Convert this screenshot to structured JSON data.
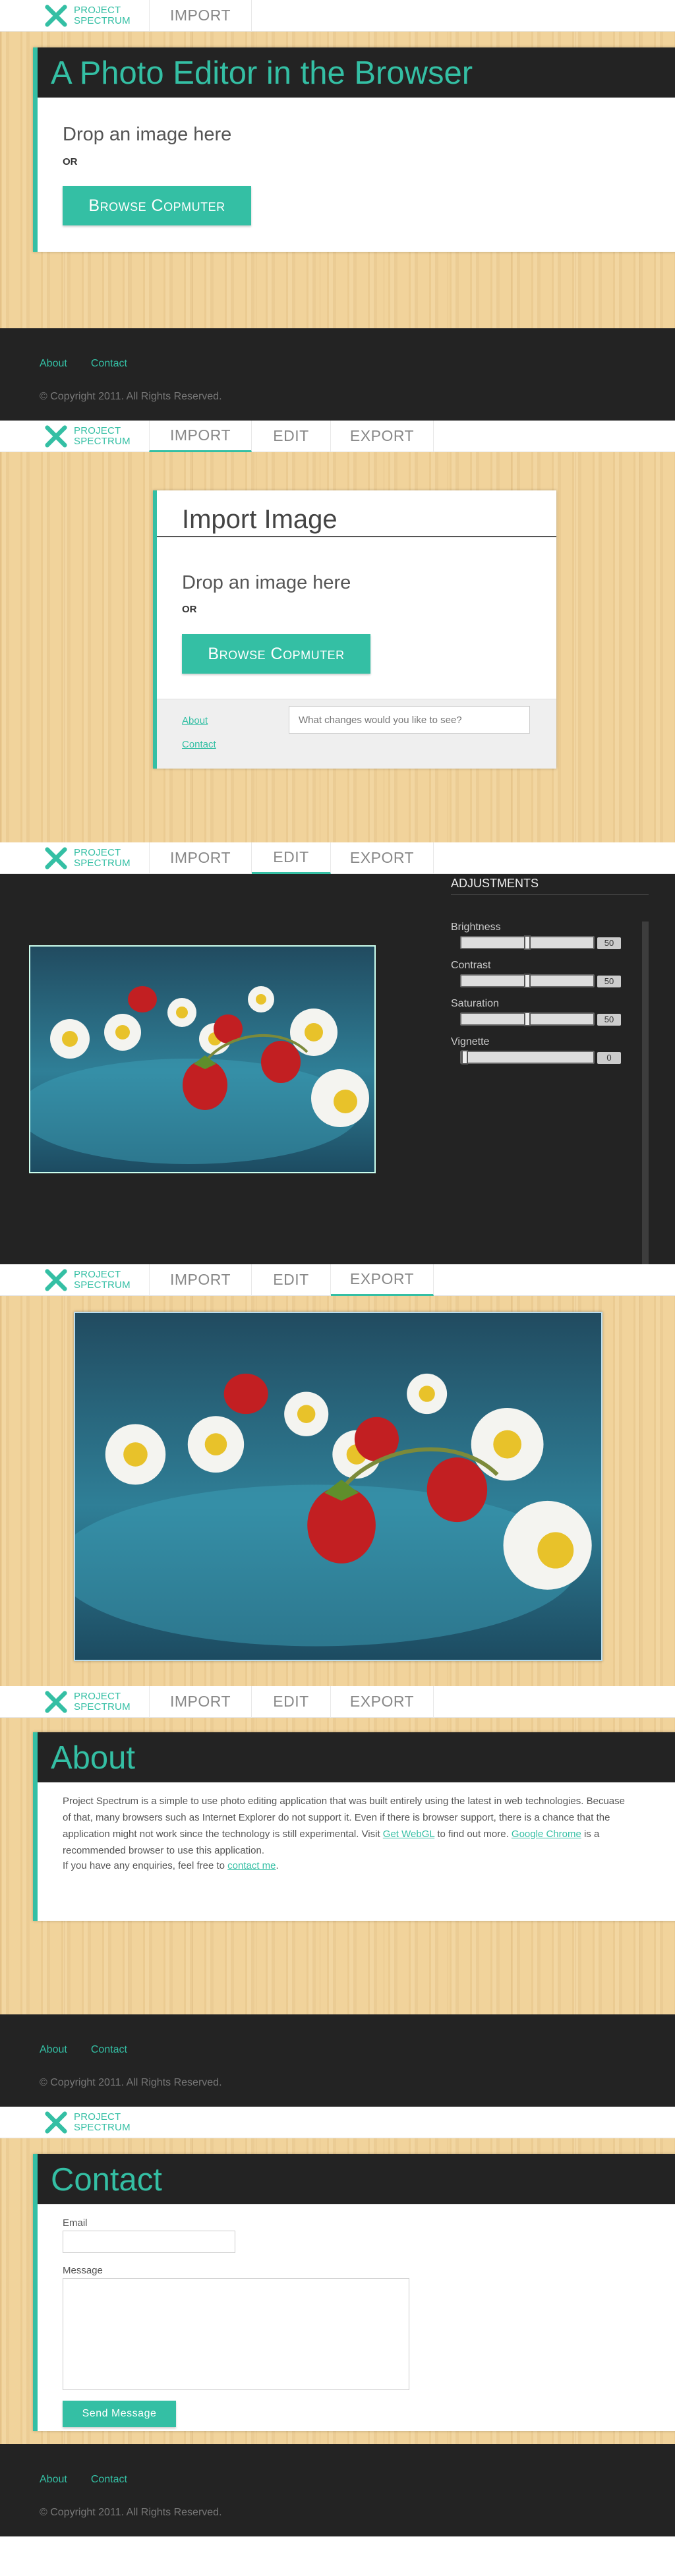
{
  "brand": {
    "line1": "PROJECT",
    "line2": "SPECTRUM"
  },
  "nav": {
    "import": "IMPORT",
    "edit": "EDIT",
    "export": "EXPORT"
  },
  "home": {
    "title": "A Photo Editor in the Browser",
    "drop": "Drop an image here",
    "or": "OR",
    "browse": "Browse Copmuter"
  },
  "footer": {
    "about": "About",
    "contact": "Contact",
    "copyright": "© Copyright 2011. All Rights Reserved."
  },
  "import_page": {
    "title": "Import Image",
    "drop": "Drop an image here",
    "or": "OR",
    "browse": "Browse Copmuter",
    "about": "About",
    "contact": "Contact",
    "feedback_placeholder": "What changes would you like to see?"
  },
  "edit_page": {
    "heading": "ADJUSTMENTS",
    "sliders": [
      {
        "label": "Brightness",
        "value": "50",
        "level": 0.5
      },
      {
        "label": "Contrast",
        "value": "50",
        "level": 0.5
      },
      {
        "label": "Saturation",
        "value": "50",
        "level": 0.5
      },
      {
        "label": "Vignette",
        "value": "0",
        "level": 0
      }
    ]
  },
  "about_page": {
    "title": "About",
    "p1_a": "Project Spectrum is a simple to use photo editing application that was built entirely using the latest in web technologies. Becuase of that, many browsers such as Internet Explorer do not support it. Even if there is browser support, there is a chance that the application might not work since the technology is still experimental. Visit ",
    "p1_link1": "Get WebGL",
    "p1_b": " to find out more. ",
    "p1_link2": "Google Chrome",
    "p1_c": " is a recommended browser to use this application.",
    "p2_a": "If you have any enquiries, feel free to ",
    "p2_link": "contact me",
    "p2_b": "."
  },
  "contact_page": {
    "title": "Contact",
    "email_label": "Email",
    "message_label": "Message",
    "send": "Send Message"
  },
  "colors": {
    "accent": "#34bfa4",
    "dark": "#232323"
  },
  "icons": {
    "logo": "x-logo-icon"
  }
}
